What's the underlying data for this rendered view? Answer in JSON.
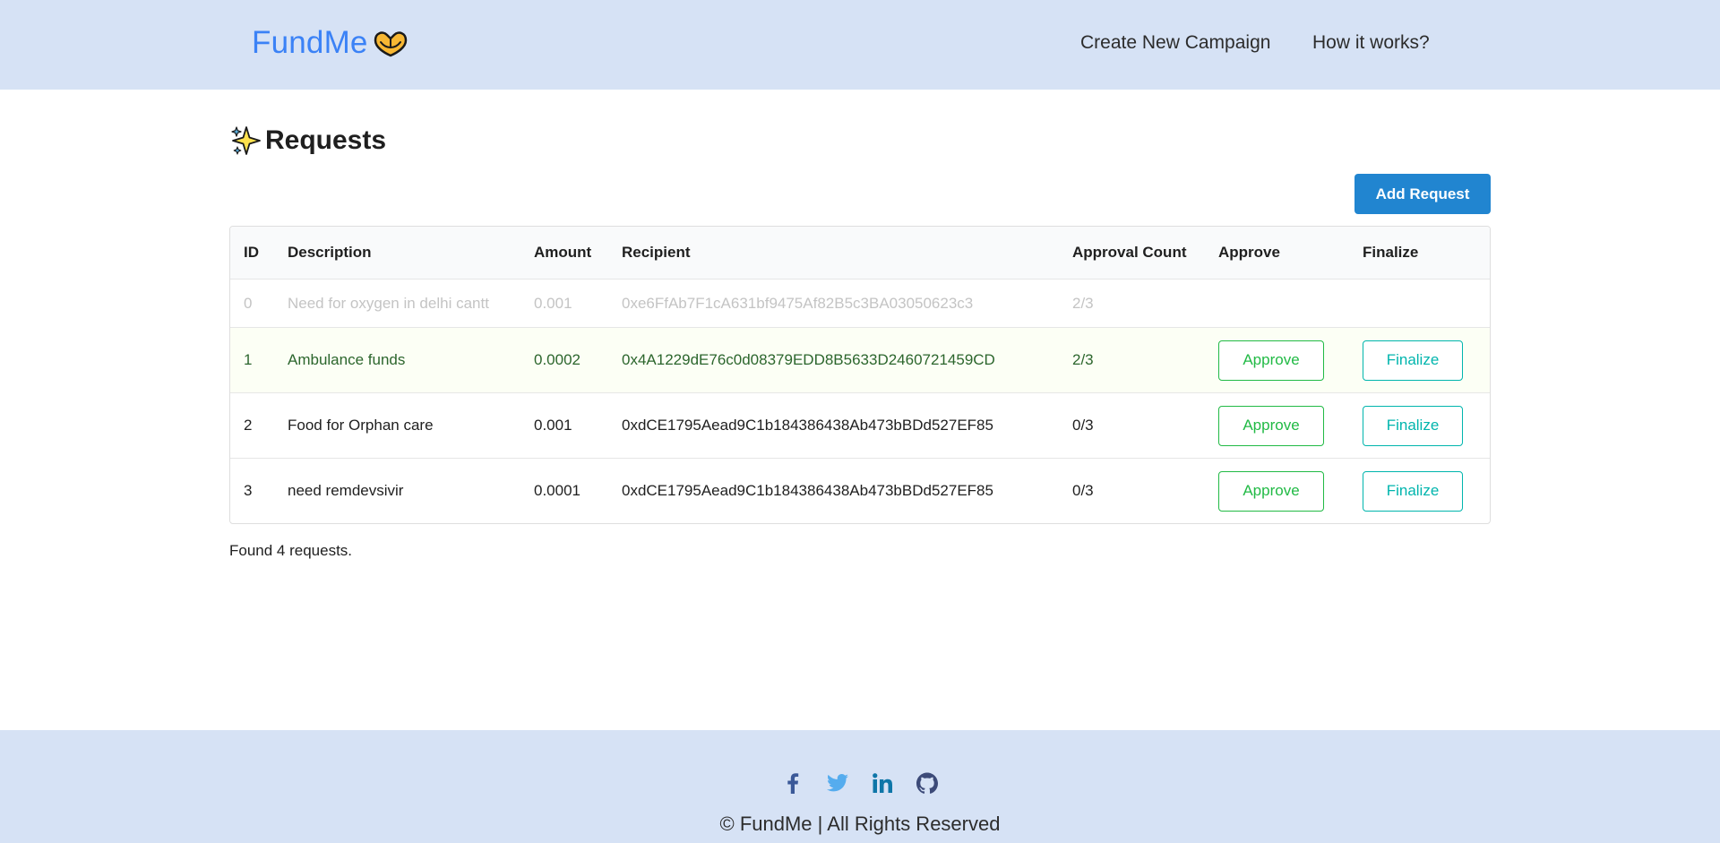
{
  "header": {
    "logo_text": "FundMe",
    "logo_icon": "heart-hands-icon",
    "nav": {
      "create": "Create New Campaign",
      "how": "How it works?"
    }
  },
  "page": {
    "title": "Requests",
    "title_icon": "sparkles-icon",
    "add_button": "Add Request",
    "found_text": "Found 4 requests."
  },
  "table": {
    "headers": {
      "id": "ID",
      "description": "Description",
      "amount": "Amount",
      "recipient": "Recipient",
      "approval_count": "Approval Count",
      "approve": "Approve",
      "finalize": "Finalize"
    },
    "rows": [
      {
        "id": "0",
        "description": "Need for oxygen in delhi cantt",
        "amount": "0.001",
        "recipient": "0xe6FfAb7F1cA631bf9475Af82B5c3BA03050623c3",
        "approval_count": "2/3",
        "status": "completed"
      },
      {
        "id": "1",
        "description": "Ambulance funds",
        "amount": "0.0002",
        "recipient": "0x4A1229dE76c0d08379EDD8B5633D2460721459CD",
        "approval_count": "2/3",
        "status": "ready",
        "approve_label": "Approve",
        "finalize_label": "Finalize"
      },
      {
        "id": "2",
        "description": "Food for Orphan care",
        "amount": "0.001",
        "recipient": "0xdCE1795Aead9C1b184386438Ab473bBDd527EF85",
        "approval_count": "0/3",
        "status": "pending",
        "approve_label": "Approve",
        "finalize_label": "Finalize"
      },
      {
        "id": "3",
        "description": "need remdevsivir",
        "amount": "0.0001",
        "recipient": "0xdCE1795Aead9C1b184386438Ab473bBDd527EF85",
        "approval_count": "0/3",
        "status": "pending",
        "approve_label": "Approve",
        "finalize_label": "Finalize"
      }
    ]
  },
  "footer": {
    "social": [
      "facebook-icon",
      "twitter-icon",
      "linkedin-icon",
      "github-icon"
    ],
    "copyright": "© FundMe | All Rights Reserved"
  },
  "colors": {
    "header_bg": "#d6e2f5",
    "brand": "#3b82f6",
    "primary_button": "#2185d0",
    "approve": "#21ba45",
    "finalize": "#00b5ad",
    "positive_row_bg": "#fcfff5",
    "positive_row_text": "#2c662d",
    "disabled_text": "#c4c4c4"
  }
}
